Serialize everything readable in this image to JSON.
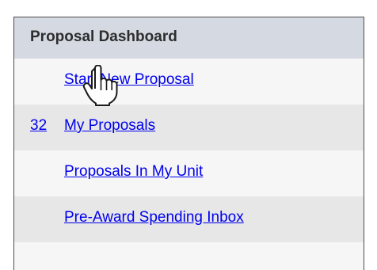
{
  "panel": {
    "title": "Proposal Dashboard"
  },
  "rows": [
    {
      "label": "Start New Proposal",
      "count": ""
    },
    {
      "label": "My Proposals",
      "count": "32"
    },
    {
      "label": "Proposals In My Unit",
      "count": ""
    },
    {
      "label": "Pre-Award Spending Inbox",
      "count": ""
    }
  ],
  "cursor": {
    "icon": "hand-pointer-icon"
  },
  "colors": {
    "link": "#0000ee",
    "header_bg": "#d5d9e2",
    "row_alt_bg": "#e7e7e7",
    "row_bg": "#f6f6f6"
  }
}
